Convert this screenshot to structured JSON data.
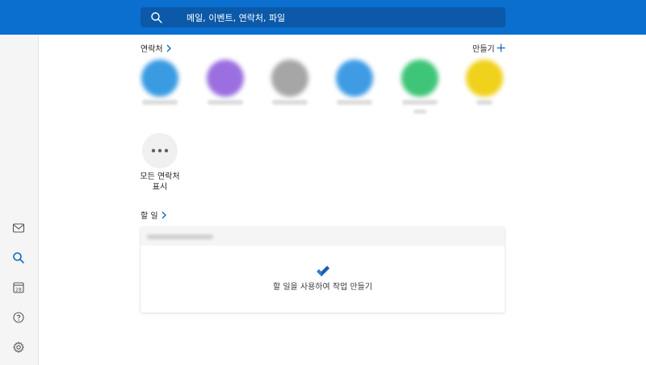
{
  "search": {
    "placeholder": "메일, 이벤트, 연락처, 파일",
    "icon": "search-icon"
  },
  "left_rail": [
    {
      "icon": "mail-icon",
      "active": false
    },
    {
      "icon": "search-icon",
      "active": true
    },
    {
      "icon": "calendar-icon",
      "text": "28",
      "active": false
    },
    {
      "icon": "help-icon",
      "active": false
    },
    {
      "icon": "settings-icon",
      "active": false
    }
  ],
  "contacts": {
    "title": "연락처",
    "create_label": "만들기",
    "avatar_colors": [
      "#3a9be3",
      "#9b6fe0",
      "#a6a6a6",
      "#3f9ce4",
      "#3fc578",
      "#f0d21c"
    ],
    "show_all_label_line1": "모든 연락처",
    "show_all_label_line2": "표시"
  },
  "todo": {
    "title": "할 일",
    "empty_message": "할 일을 사용하여 작업 만들기"
  },
  "colors": {
    "brand": "#0a6fcf",
    "accent": "#0f6cbd"
  }
}
